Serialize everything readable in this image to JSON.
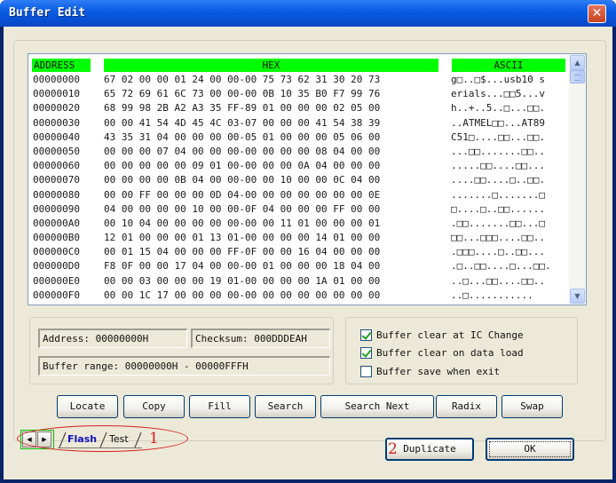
{
  "window": {
    "title": "Buffer Edit",
    "close_glyph": "✕"
  },
  "grid": {
    "headers": {
      "address": "ADDRESS",
      "hex": "HEX",
      "ascii": "ASCII"
    },
    "rows": [
      {
        "address": "00000000",
        "hex": "67 02 00 00 01 24 00 00-00 75 73 62 31 30 20 73",
        "ascii": "g□..□$...usb10 s"
      },
      {
        "address": "00000010",
        "hex": "65 72 69 61 6C 73 00 00-00 0B 10 35 B0 F7 99 76",
        "ascii": "erials...□□5...v"
      },
      {
        "address": "00000020",
        "hex": "68 99 98 2B A2 A3 35 FF-89 01 00 00 00 02 05 00",
        "ascii": "h..+..5..□...□□."
      },
      {
        "address": "00000030",
        "hex": "00 00 41 54 4D 45 4C 03-07 00 00 00 41 54 38 39",
        "ascii": "..ATMEL□□...AT89"
      },
      {
        "address": "00000040",
        "hex": "43 35 31 04 00 00 00 00-05 01 00 00 00 05 06 00",
        "ascii": "C51□....□□...□□."
      },
      {
        "address": "00000050",
        "hex": "00 00 00 07 04 00 00 00-00 00 00 00 08 04 00 00",
        "ascii": "...□□.......□□.."
      },
      {
        "address": "00000060",
        "hex": "00 00 00 00 00 09 01 00-00 00 00 0A 04 00 00 00",
        "ascii": ".....□□....□□..."
      },
      {
        "address": "00000070",
        "hex": "00 00 00 00 0B 04 00 00-00 00 10 00 00 0C 04 00",
        "ascii": "....□□....□..□□."
      },
      {
        "address": "00000080",
        "hex": "00 00 FF 00 00 00 0D 04-00 00 00 00 00 00 00 0E",
        "ascii": ".......□.......□"
      },
      {
        "address": "00000090",
        "hex": "04 00 00 00 00 10 00 00-0F 04 00 00 00 FF 00 00",
        "ascii": "□....□..□□......"
      },
      {
        "address": "000000A0",
        "hex": "00 10 04 00 00 00 00 00-00 00 11 01 00 00 00 01",
        "ascii": ".□□.......□□...□"
      },
      {
        "address": "000000B0",
        "hex": "12 01 00 00 00 01 13 01-00 00 00 00 14 01 00 00",
        "ascii": "□□...□□□....□□.."
      },
      {
        "address": "000000C0",
        "hex": "00 01 15 04 00 00 00 FF-0F 00 00 16 04 00 00 00",
        "ascii": ".□□□....□..□□..."
      },
      {
        "address": "000000D0",
        "hex": "F8 0F 00 00 17 04 00 00-00 01 00 00 00 18 04 00",
        "ascii": ".□..□□....□...□□."
      },
      {
        "address": "000000E0",
        "hex": "00 00 03 00 00 00 19 01-00 00 00 00 1A 01 00 00",
        "ascii": "..□...□□....□□.."
      },
      {
        "address": "000000F0",
        "hex": "00 00 1C 17 00 00 00 00-00 00 00 00 00 00 00 00",
        "ascii": "..□..........."
      }
    ]
  },
  "info": {
    "address_field": "Address: 00000000H",
    "checksum_field": "Checksum: 000DDDEAH",
    "range_field": "Buffer range: 00000000H - 00000FFFH"
  },
  "options": {
    "clear_on_ic_change": {
      "label": "Buffer clear at IC Change",
      "checked": true
    },
    "clear_on_data_load": {
      "label": "Buffer clear on data load",
      "checked": true
    },
    "save_when_exit": {
      "label": "Buffer save when exit",
      "checked": false
    }
  },
  "buttons": {
    "locate": "Locate",
    "copy": "Copy",
    "fill": "Fill",
    "search": "Search",
    "search_next": "Search Next",
    "radix": "Radix",
    "swap": "Swap",
    "duplicate": "Duplicate",
    "ok": "OK"
  },
  "tabs": {
    "items": [
      "Flash",
      "Test"
    ],
    "active": "Flash",
    "prev_glyph": "◀",
    "next_glyph": "▶"
  },
  "annotations": {
    "marker_1": "1",
    "marker_2": "2"
  },
  "scrollbar": {
    "up_glyph": "▲",
    "down_glyph": "▼"
  },
  "colors": {
    "header_green": "#00ff00",
    "title_blue": "#0a5ee4",
    "annotation_red": "#d81e1e",
    "active_tab": "#1010c0"
  }
}
